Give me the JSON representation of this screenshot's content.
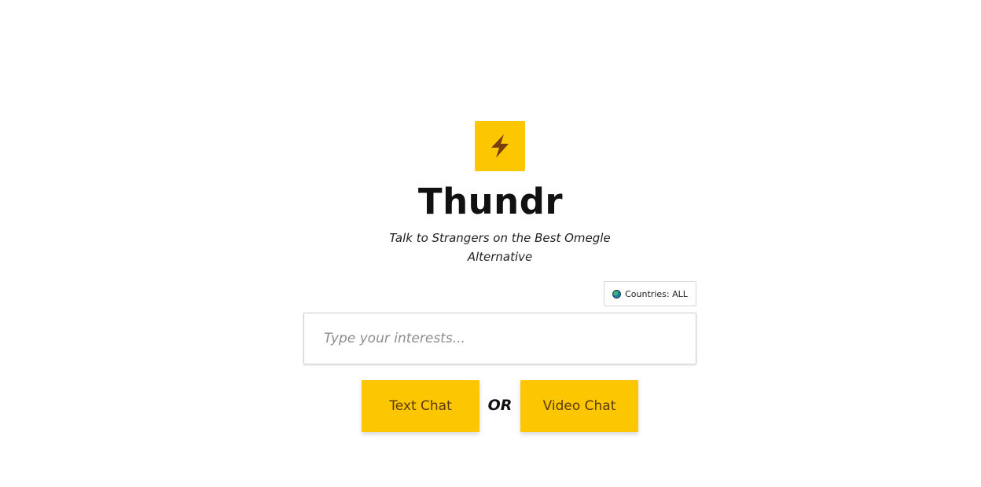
{
  "app": {
    "title": "Thundr",
    "tagline": "Talk to Strangers on the Best Omegle Alternative",
    "logo_icon": "lightning-bolt-icon",
    "accent_color": "#fcc600",
    "icon_color": "#7a3e0a"
  },
  "country_filter": {
    "label": "Countries: ALL",
    "icon": "globe-icon"
  },
  "interests": {
    "value": "",
    "placeholder": "Type your interests..."
  },
  "actions": {
    "text_chat_label": "Text Chat",
    "or_label": "OR",
    "video_chat_label": "Video Chat"
  }
}
